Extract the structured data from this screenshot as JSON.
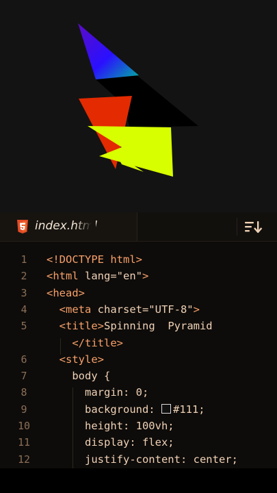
{
  "tab": {
    "filename": "index.html",
    "icon": "html5-icon",
    "accent": "#e34c26"
  },
  "toolbar": {
    "sort_icon": "sort-descending-icon"
  },
  "code": {
    "lines": [
      {
        "n": "1",
        "parts": [
          [
            "tag",
            "<!DOCTYPE html>"
          ]
        ]
      },
      {
        "n": "2",
        "parts": [
          [
            "tag",
            "<html "
          ],
          [
            "attr",
            "lang=\"en\""
          ],
          [
            "tag",
            ">"
          ]
        ]
      },
      {
        "n": "3",
        "parts": [
          [
            "tag",
            "<head>"
          ]
        ]
      },
      {
        "n": "4",
        "parts": [
          [
            "tag",
            "  <meta "
          ],
          [
            "attr",
            "charset=\"UTF-8\""
          ],
          [
            "tag",
            ">"
          ]
        ]
      },
      {
        "n": "5",
        "parts": [
          [
            "tag",
            "  <title>"
          ],
          [
            "punc",
            "Spinning  Pyramid"
          ]
        ]
      },
      {
        "n": "",
        "parts": [
          [
            "tag",
            "    </title>"
          ]
        ]
      },
      {
        "n": "6",
        "parts": [
          [
            "tag",
            "  <style>"
          ]
        ]
      },
      {
        "n": "7",
        "parts": [
          [
            "prop",
            "    body {"
          ]
        ]
      },
      {
        "n": "8",
        "parts": [
          [
            "prop",
            "      margin: 0;"
          ]
        ]
      },
      {
        "n": "9",
        "parts": [
          [
            "prop",
            "      background: "
          ],
          [
            "swatch",
            ""
          ],
          [
            "prop",
            "#111;"
          ]
        ]
      },
      {
        "n": "10",
        "parts": [
          [
            "prop",
            "      height: 100vh;"
          ]
        ]
      },
      {
        "n": "11",
        "parts": [
          [
            "prop",
            "      display: flex;"
          ]
        ]
      },
      {
        "n": "12",
        "parts": [
          [
            "prop",
            "      justify-content: center;"
          ]
        ]
      }
    ]
  },
  "colors": {
    "preview_bg": "#131313",
    "swatch": "#111111",
    "tag": "#f7a06a",
    "text": "#f0d2b7",
    "line_number": "#8b6f58"
  }
}
